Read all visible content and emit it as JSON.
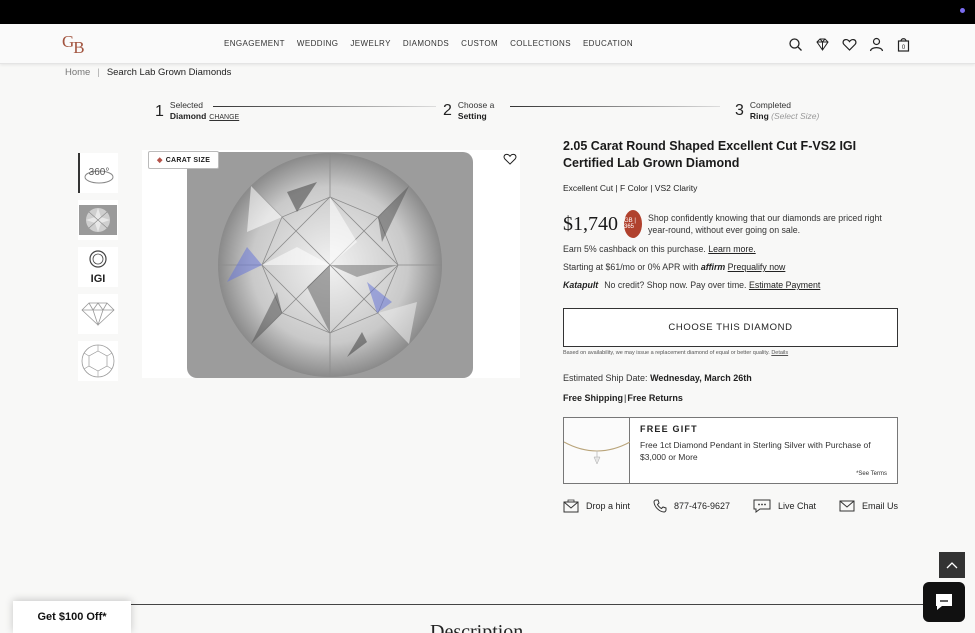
{
  "header": {
    "logo": "GB",
    "nav": [
      "ENGAGEMENT",
      "WEDDING",
      "JEWELRY",
      "DIAMONDS",
      "CUSTOM",
      "COLLECTIONS",
      "EDUCATION"
    ],
    "icons": [
      "search-icon",
      "diamond-icon",
      "heart-icon",
      "user-icon",
      "bag-icon"
    ],
    "cart_count": "0"
  },
  "breadcrumb": {
    "home": "Home",
    "current": "Search Lab Grown Diamonds"
  },
  "steps": [
    {
      "num": "1",
      "label": "Selected",
      "item": "Diamond",
      "action": "CHANGE"
    },
    {
      "num": "2",
      "label": "Choose a",
      "item": "Setting"
    },
    {
      "num": "3",
      "label": "Completed",
      "item": "Ring",
      "note": "(Select Size)"
    }
  ],
  "gallery": {
    "carat_badge": "CARAT SIZE",
    "thumb_360": "360°",
    "thumb_igi": "IGI",
    "thumbs": [
      "360-view-icon",
      "diamond-photo",
      "igi-certificate-icon",
      "diamond-profile-icon",
      "diamond-top-icon"
    ]
  },
  "product": {
    "title": "2.05 Carat Round Shaped Excellent Cut F-VS2 IGI Certified Lab Grown Diamond",
    "specs": "Excellent Cut | F Color | VS2 Clarity",
    "price": "$1,740",
    "badge": "GB | 365",
    "price_note": "Shop confidently knowing that our diamonds are priced right year-round, without ever going on sale.",
    "cashback": "Earn 5% cashback on this purchase.",
    "learn_more": "Learn more.",
    "financing": "Starting at $61/mo or 0% APR with",
    "affirm": "affirm",
    "prequalify": "Prequalify now",
    "katapult": "Katapult",
    "katapult_text": "No credit? Shop now. Pay over time.",
    "estimate": "Estimate Payment",
    "choose_button": "CHOOSE THIS DIAMOND",
    "disclaimer": "Based on availability, we may issue a replacement diamond of equal or better quality.",
    "details": "Details",
    "ship_label": "Estimated Ship Date:",
    "ship_date": "Wednesday, March 26th",
    "free_shipping": "Free Shipping",
    "free_returns": "Free Returns"
  },
  "gift": {
    "title": "FREE GIFT",
    "desc": "Free 1ct Diamond Pendant in Sterling Silver with Purchase of $3,000 or More",
    "terms": "*See Terms"
  },
  "contact": [
    {
      "icon": "envelope-hint-icon",
      "label": "Drop a hint"
    },
    {
      "icon": "phone-icon",
      "label": "877-476-9627"
    },
    {
      "icon": "chat-bubble-icon",
      "label": "Live Chat"
    },
    {
      "icon": "mail-icon",
      "label": "Email Us"
    }
  ],
  "description_heading": "Description",
  "promo": "Get $100 Off*"
}
